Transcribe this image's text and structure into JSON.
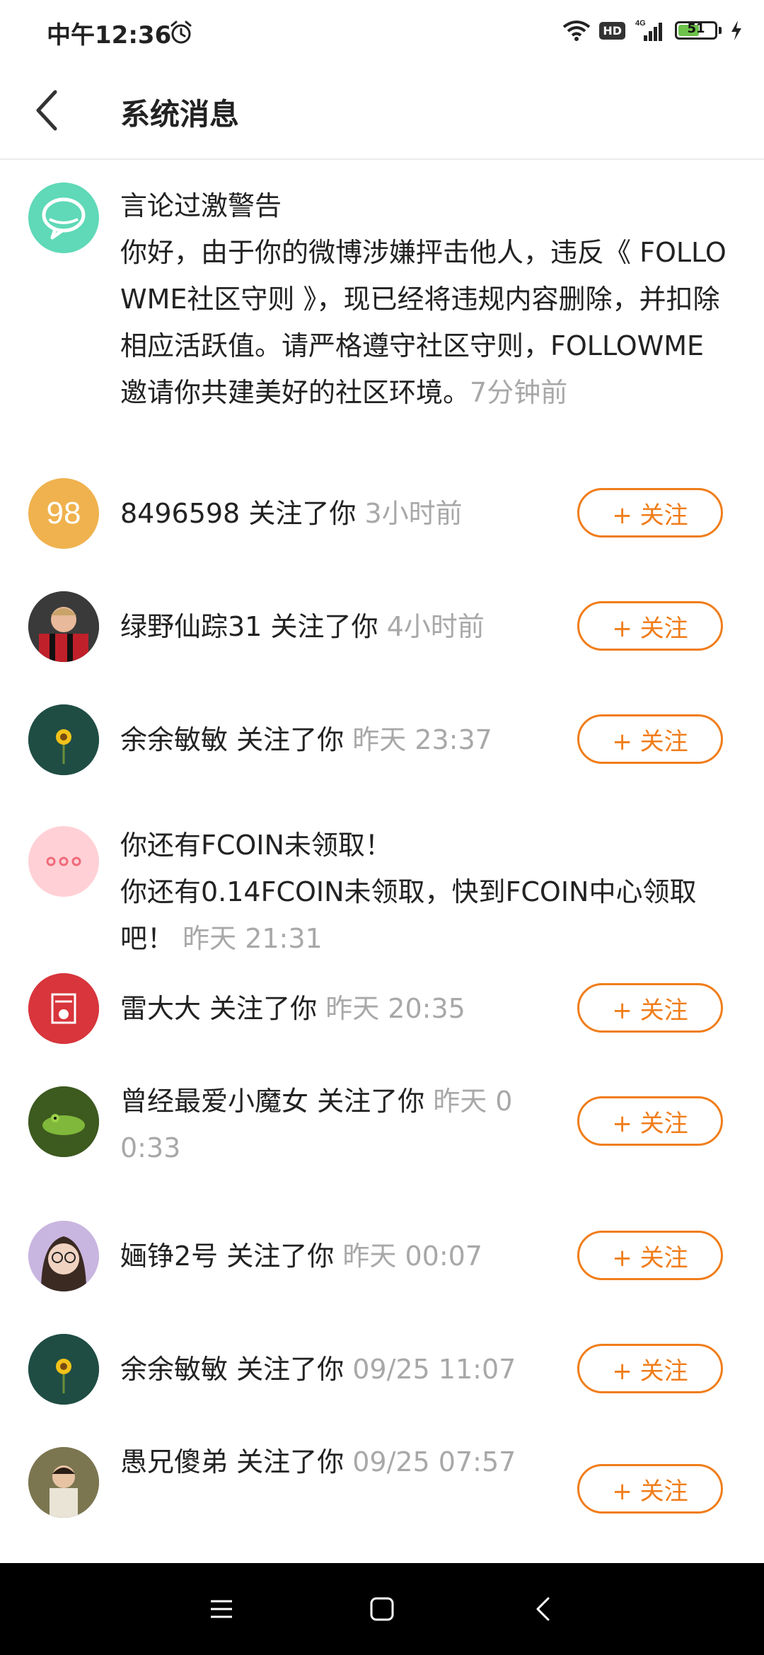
{
  "status_bar": {
    "time": "中午12:36",
    "hd": "HD",
    "network": "4G",
    "battery": "51",
    "battery_level": 0.51
  },
  "header": {
    "title": "系统消息"
  },
  "messages": [
    {
      "type": "notice",
      "title": "言论过激警告",
      "body": "你好，由于你的微博涉嫌抨击他人，违反《 FOLLOWME社区守则 》，现已经将违规内容删除，并扣除相应活跃值。请严格遵守社区守则，FOLLOWME 邀请你共建美好的社区环境。",
      "time": "7分钟前",
      "avatar_icon": "chat-bubble-icon",
      "avatar_color": "#5fd9b7"
    },
    {
      "type": "follow",
      "user": "8496598",
      "action": "关注了你",
      "time": "3小时前",
      "avatar_text": "98",
      "avatar_color": "#efb24e",
      "button": "+ 关注"
    },
    {
      "type": "follow",
      "user": "绿野仙踪31",
      "action": "关注了你",
      "time": "4小时前",
      "avatar_icon": "soccer-player-photo",
      "button": "+ 关注"
    },
    {
      "type": "follow",
      "user": "余余敏敏",
      "action": "关注了你",
      "time": "昨天 23:37",
      "avatar_icon": "sunflower-photo",
      "button": "+ 关注"
    },
    {
      "type": "notice",
      "title": "你还有FCOIN未领取！",
      "body": "你还有0.14FCOIN未领取，快到FCOIN中心领取吧！",
      "time": "昨天 21:31",
      "avatar_icon": "more-dots-icon",
      "avatar_color": "#ffd1d6"
    },
    {
      "type": "follow",
      "user": "雷大大",
      "action": "关注了你",
      "time": "昨天 20:35",
      "avatar_icon": "red-badge-photo",
      "button": "+ 关注"
    },
    {
      "type": "follow",
      "user": "曾经最爱小魔女",
      "action": "关注了你",
      "time": "昨天 00:33",
      "avatar_icon": "green-frog-photo",
      "button": "+ 关注"
    },
    {
      "type": "follow",
      "user": "婳铮2号",
      "action": "关注了你",
      "time": "昨天 00:07",
      "avatar_icon": "girl-glasses-photo",
      "button": "+ 关注"
    },
    {
      "type": "follow",
      "user": "余余敏敏",
      "action": "关注了你",
      "time": "09/25 11:07",
      "avatar_icon": "sunflower-photo",
      "button": "+ 关注"
    },
    {
      "type": "follow",
      "user": "愚兄傻弟",
      "action": "关注了你",
      "time": "09/25 07:57",
      "avatar_icon": "child-photo",
      "button": "+ 关注"
    }
  ],
  "nav_bar": {
    "items": [
      "menu-icon",
      "home-square-icon",
      "back-triangle-icon"
    ]
  }
}
